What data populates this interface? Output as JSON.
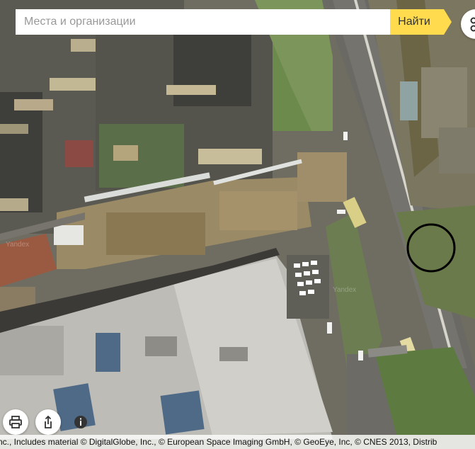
{
  "search": {
    "placeholder": "Места и организации",
    "button_label": "Найти"
  },
  "map": {
    "type": "satellite",
    "watermark": "Yandex",
    "marker": "circle"
  },
  "controls": {
    "route_icon": "route-icon",
    "print_icon": "printer-icon",
    "share_icon": "share-icon",
    "info_icon": "info-icon"
  },
  "attribution": "nc., Includes material © DigitalGlobe, Inc., © European Space Imaging GmbH, © GeoEye, Inc, © CNES 2013, Distrib",
  "colors": {
    "search_button": "#ffdb4d",
    "marker_stroke": "#000000"
  }
}
